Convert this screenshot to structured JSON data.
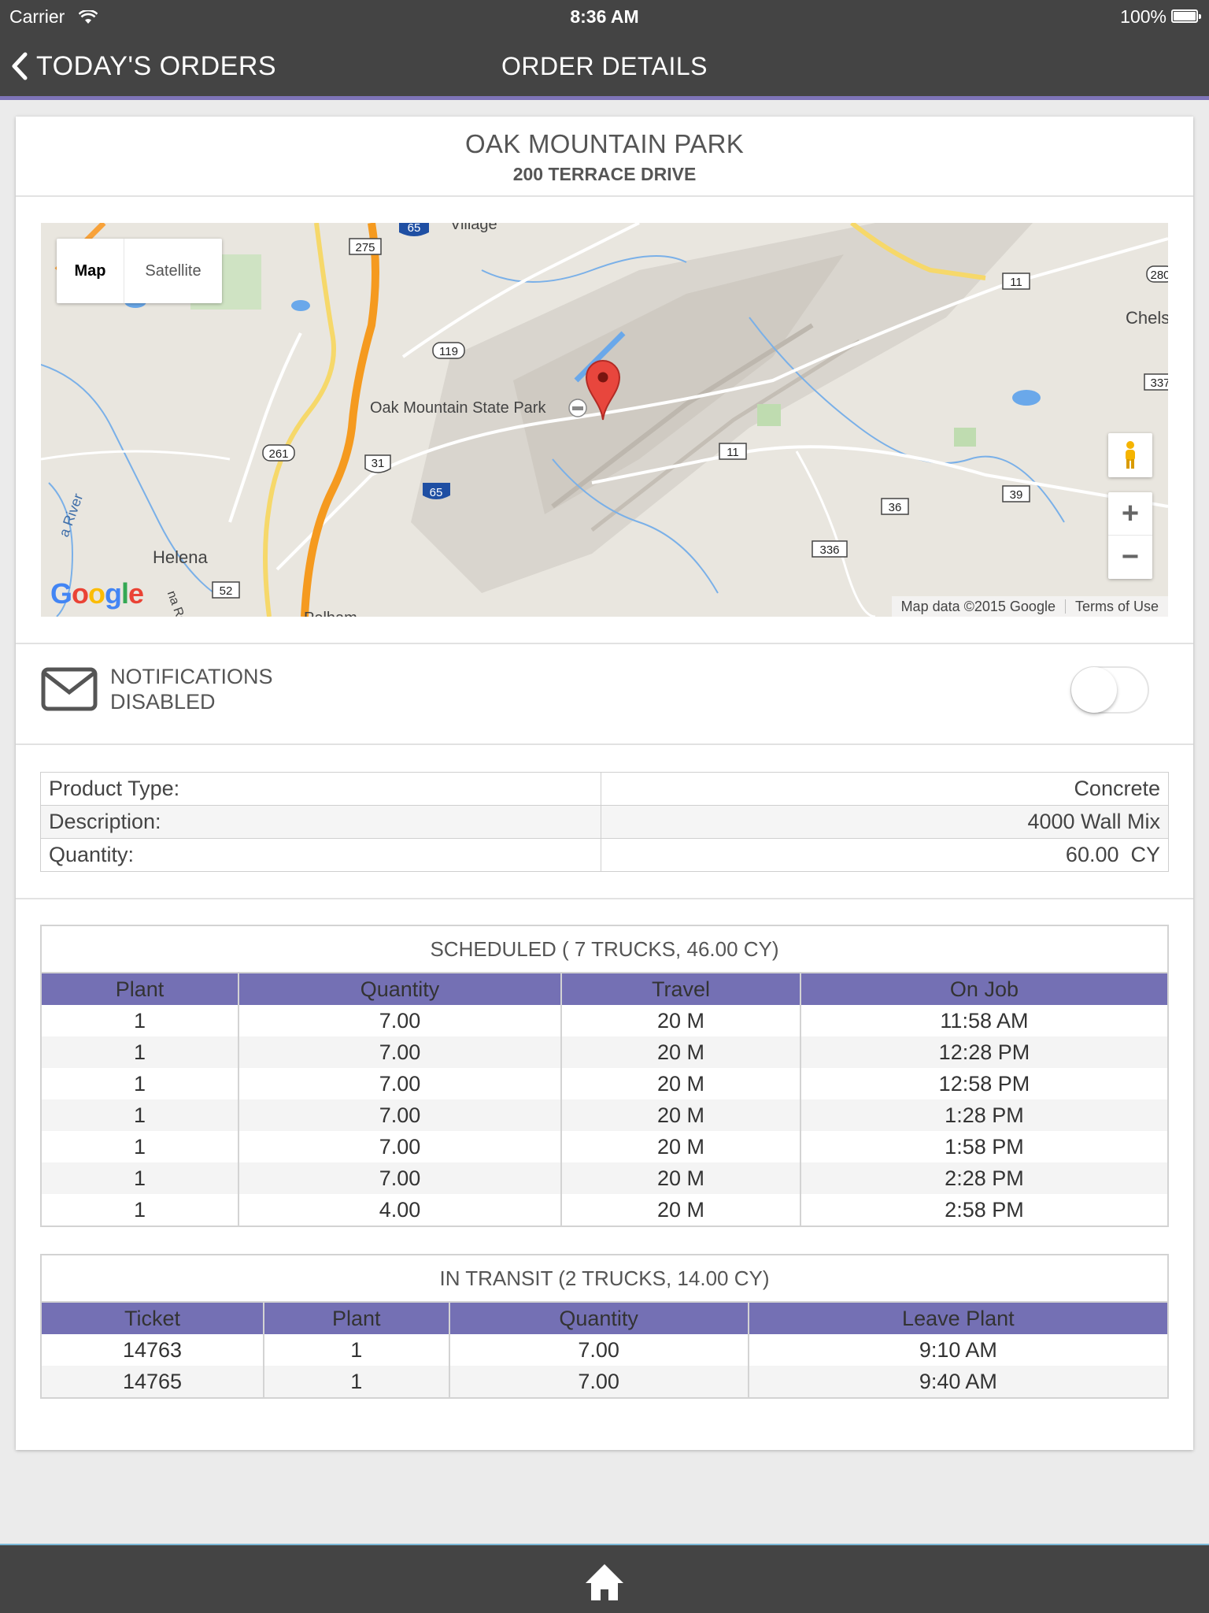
{
  "status_bar": {
    "carrier": "Carrier",
    "time": "8:36 AM",
    "battery": "100%"
  },
  "nav": {
    "back_label": "TODAY'S ORDERS",
    "title": "ORDER DETAILS"
  },
  "order": {
    "name": "OAK MOUNTAIN PARK",
    "address": "200 TERRACE DRIVE"
  },
  "map": {
    "type_map": "Map",
    "type_satellite": "Satellite",
    "zoom_in": "+",
    "zoom_out": "−",
    "attribution": "Map data ©2015 Google",
    "terms": "Terms of Use",
    "poi_label": "Oak Mountain State Park",
    "labels": [
      "Village",
      "Chels",
      "Helena",
      "a River",
      "Pelham",
      "na Rd"
    ],
    "route_shields": [
      "275",
      "65",
      "119",
      "261",
      "31",
      "65",
      "52",
      "11",
      "280",
      "337",
      "11",
      "36",
      "39",
      "336"
    ]
  },
  "notifications": {
    "line1": "NOTIFICATIONS",
    "line2": "DISABLED",
    "enabled": false
  },
  "product": {
    "rows": [
      {
        "label": "Product Type:",
        "value": "Concrete"
      },
      {
        "label": "Description:",
        "value": "4000 Wall Mix"
      },
      {
        "label": "Quantity:",
        "value": "60.00  CY"
      }
    ]
  },
  "scheduled": {
    "caption": "SCHEDULED ( 7 TRUCKS, 46.00 CY)",
    "headers": [
      "Plant",
      "Quantity",
      "Travel",
      "On Job"
    ],
    "rows": [
      [
        "1",
        "7.00",
        "20 M",
        "11:58 AM"
      ],
      [
        "1",
        "7.00",
        "20 M",
        "12:28 PM"
      ],
      [
        "1",
        "7.00",
        "20 M",
        "12:58 PM"
      ],
      [
        "1",
        "7.00",
        "20 M",
        "1:28 PM"
      ],
      [
        "1",
        "7.00",
        "20 M",
        "1:58 PM"
      ],
      [
        "1",
        "7.00",
        "20 M",
        "2:28 PM"
      ],
      [
        "1",
        "4.00",
        "20 M",
        "2:58 PM"
      ]
    ]
  },
  "in_transit": {
    "caption": "IN TRANSIT (2 TRUCKS, 14.00 CY)",
    "headers": [
      "Ticket",
      "Plant",
      "Quantity",
      "Leave Plant"
    ],
    "rows": [
      [
        "14763",
        "1",
        "7.00",
        "9:10 AM"
      ],
      [
        "14765",
        "1",
        "7.00",
        "9:40 AM"
      ]
    ]
  },
  "colors": {
    "bar": "#444444",
    "accent": "#7470b4",
    "background": "#ebebeb"
  },
  "icons": [
    "chevron-left-icon",
    "wifi-icon",
    "battery-icon",
    "envelope-icon",
    "map-pin-icon",
    "pegman-icon",
    "home-icon"
  ]
}
